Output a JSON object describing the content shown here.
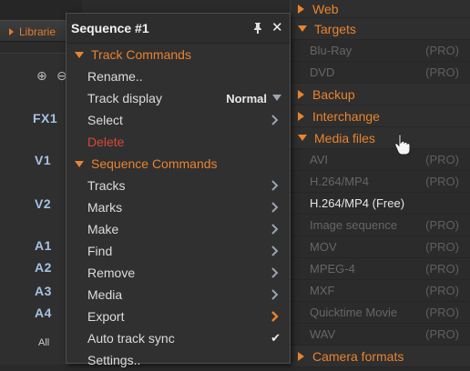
{
  "background": {
    "libraries_label": "Librarie",
    "tracks": [
      "FX1",
      "V1",
      "V2",
      "A1",
      "A2",
      "A3",
      "A4"
    ],
    "all_label": "All"
  },
  "menu": {
    "title": "Sequence #1",
    "sections": [
      {
        "label": "Track Commands",
        "items": [
          {
            "label": "Rename.."
          },
          {
            "label": "Track display",
            "value": "Normal"
          },
          {
            "label": "Select"
          },
          {
            "label": "Delete"
          }
        ]
      },
      {
        "label": "Sequence Commands",
        "items": [
          {
            "label": "Tracks"
          },
          {
            "label": "Marks"
          },
          {
            "label": "Make"
          },
          {
            "label": "Find"
          },
          {
            "label": "Remove"
          },
          {
            "label": "Media"
          },
          {
            "label": "Export"
          },
          {
            "label": "Auto track sync"
          },
          {
            "label": "Settings.."
          }
        ]
      }
    ]
  },
  "submenu": {
    "web": "Web",
    "targets": {
      "label": "Targets",
      "items": [
        {
          "label": "Blu-Ray",
          "tag": "(PRO)"
        },
        {
          "label": "DVD",
          "tag": "(PRO)"
        }
      ]
    },
    "backup": "Backup",
    "interchange": "Interchange",
    "media_files": {
      "label": "Media files",
      "items": [
        {
          "label": "AVI",
          "tag": "(PRO)"
        },
        {
          "label": "H.264/MP4",
          "tag": "(PRO)"
        },
        {
          "label": "H.264/MP4 (Free)",
          "tag": ""
        },
        {
          "label": "Image sequence",
          "tag": "(PRO)"
        },
        {
          "label": "MOV",
          "tag": "(PRO)"
        },
        {
          "label": "MPEG-4",
          "tag": "(PRO)"
        },
        {
          "label": "MXF",
          "tag": "(PRO)"
        },
        {
          "label": "Quicktime Movie",
          "tag": "(PRO)"
        },
        {
          "label": "WAV",
          "tag": "(PRO)"
        }
      ]
    },
    "camera_formats": "Camera formats"
  },
  "colors": {
    "accent": "#e9832f",
    "danger": "#d9483a",
    "track_label": "#a6c3e4",
    "panel": "#303030"
  }
}
